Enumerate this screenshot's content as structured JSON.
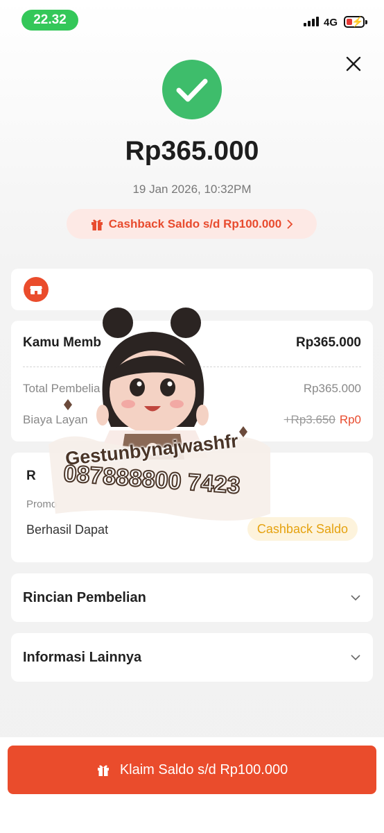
{
  "status_bar": {
    "time": "22.32",
    "network": "4G"
  },
  "summary": {
    "amount": "Rp365.000",
    "date": "19 Jan 2026, 10:32PM",
    "cashback_pill": "Cashback Saldo s/d Rp100.000"
  },
  "payment": {
    "title": "Kamu Memb",
    "title_amount": "Rp365.000",
    "total_label": "Total Pembelia",
    "total_value": "Rp365.000",
    "fee_label": "Biaya Layan",
    "fee_original": "+Rp3.650",
    "fee_value": "Rp0"
  },
  "promo": {
    "heading": "R",
    "label": "Promo",
    "result_label": "Berhasil Dapat",
    "badge": "Cashback Saldo"
  },
  "accordions": {
    "details": "Rincian Pembelian",
    "info": "Informasi Lainnya"
  },
  "cta": {
    "label": "Klaim Saldo s/d Rp100.000"
  },
  "watermark": {
    "line1": "Gestunbynajwashfr",
    "line2": "087888800 7423"
  },
  "colors": {
    "brand": "#ea4c2c",
    "success": "#3ebd6b",
    "cashback_text": "#e5a20f"
  }
}
